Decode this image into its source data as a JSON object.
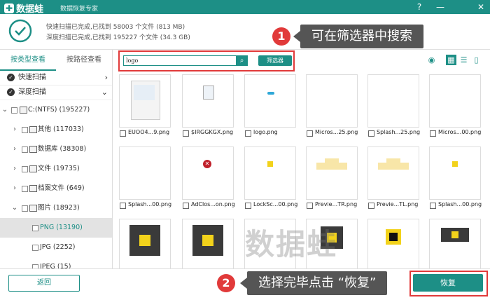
{
  "titlebar": {
    "app_name": "数据蛙",
    "subtitle": "数据恢复专家",
    "help_icon": "question-circle-icon",
    "min_icon": "minimize-icon",
    "close_icon": "close-icon",
    "color": "#1d8f86"
  },
  "header": {
    "quick_status": "快速扫描已完成,已找到 58003 个文件 (813 MB)",
    "deep_status": "深度扫描已完成,已找到 195227 个文件 (34.3 GB)"
  },
  "annotations": {
    "step1_num": "1",
    "step1_text": "可在筛选器中搜索",
    "step2_num": "2",
    "step2_text": "选择完毕点击 “恢复”",
    "marker_color": "#e13a3a"
  },
  "sidebar": {
    "tabs": [
      {
        "label": "按类型查看"
      },
      {
        "label": "按路径查看"
      }
    ],
    "scans": [
      {
        "label": "快速扫描"
      },
      {
        "label": "深度扫描"
      }
    ],
    "tree": [
      {
        "label": "C:(NTFS) (195227)"
      },
      {
        "label": "其他 (117033)"
      },
      {
        "label": "数据库 (38308)"
      },
      {
        "label": "文件 (19735)"
      },
      {
        "label": "档案文件 (649)"
      },
      {
        "label": "图片 (18923)"
      },
      {
        "label": "PNG (13190)"
      },
      {
        "label": "JPG (2252)"
      },
      {
        "label": "JPEG (15)"
      }
    ]
  },
  "search": {
    "value": "logo",
    "filter_label": "筛选器"
  },
  "files": [
    {
      "name": "EUOO4...9.png"
    },
    {
      "name": "$IRGGKGX.png"
    },
    {
      "name": "logo.png"
    },
    {
      "name": "Micros...25.png"
    },
    {
      "name": "Splash...25.png"
    },
    {
      "name": "Micros...00.png"
    },
    {
      "name": "Splash...00.png"
    },
    {
      "name": "AdClos...on.png"
    },
    {
      "name": "LockSc...00.png"
    },
    {
      "name": "Previe...TR.png"
    },
    {
      "name": "Previe...TL.png"
    },
    {
      "name": "Splash...00.png"
    }
  ],
  "footer": {
    "back_label": "返回",
    "recover_label": "恢复"
  },
  "watermark": "数据蛙"
}
